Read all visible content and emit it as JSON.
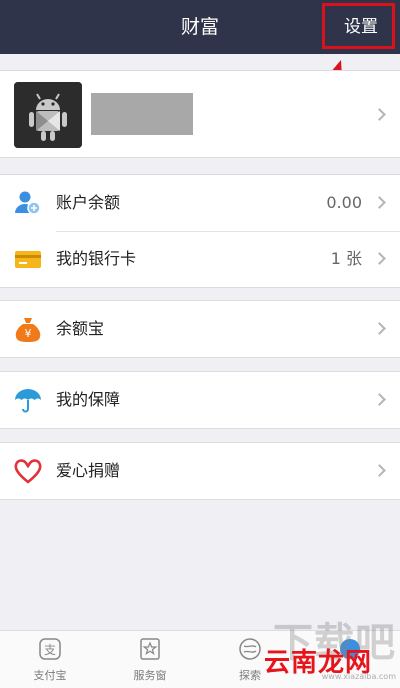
{
  "header": {
    "title": "财富",
    "settings_label": "设置"
  },
  "profile": {
    "avatar": "android-avatar"
  },
  "groups": [
    {
      "rows": [
        {
          "label": "账户余额",
          "value": "0.00",
          "icon": "account-user-icon"
        },
        {
          "label": "我的银行卡",
          "value": "1 张",
          "icon": "bank-card-icon"
        }
      ]
    },
    {
      "rows": [
        {
          "label": "余额宝",
          "value": "",
          "icon": "yuebao-bag-icon"
        }
      ]
    },
    {
      "rows": [
        {
          "label": "我的保障",
          "value": "",
          "icon": "umbrella-icon"
        }
      ]
    },
    {
      "rows": [
        {
          "label": "爱心捐赠",
          "value": "",
          "icon": "heart-icon"
        }
      ]
    }
  ],
  "tabbar": {
    "items": [
      {
        "label": "支付宝",
        "icon": "alipay-icon"
      },
      {
        "label": "服务窗",
        "icon": "star-window-icon"
      },
      {
        "label": "探索",
        "icon": "explore-icon"
      },
      {
        "label": "",
        "icon": "wealth-icon"
      }
    ]
  },
  "watermark": {
    "big": "下载吧",
    "red": "云南龙网",
    "url": "www.xiazaiba.com"
  },
  "colors": {
    "nav_bg": "#30344a",
    "page_bg": "#efeff4",
    "highlight": "#d9121b",
    "account_blue": "#3b8fe0",
    "card_yellow": "#f5b51b",
    "yuebao_orange": "#f07a1a",
    "umbrella_blue": "#2a9ad8",
    "heart_red": "#e2323a"
  }
}
